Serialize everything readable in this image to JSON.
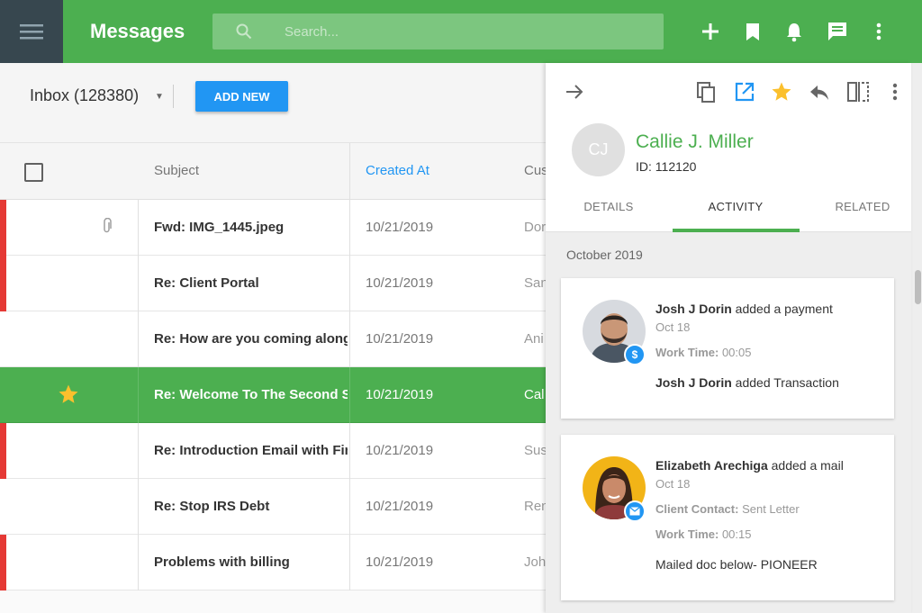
{
  "app": {
    "title": "Messages"
  },
  "search": {
    "placeholder": "Search..."
  },
  "topbar_icons": [
    "plus-icon",
    "bookmark-icon",
    "bell-icon",
    "chat-icon",
    "more-vert-icon"
  ],
  "toolbar": {
    "inbox_label": "Inbox (128380)",
    "add_new_label": "ADD NEW"
  },
  "table": {
    "headers": {
      "subject": "Subject",
      "created_at": "Created At",
      "customer": "Cus"
    },
    "rows": [
      {
        "subject": "Fwd: IMG_1445.jpeg",
        "date": "10/21/2019",
        "customer": "Dor",
        "flag": true,
        "attachment": true,
        "starred": false,
        "selected": false
      },
      {
        "subject": "Re: Client Portal",
        "date": "10/21/2019",
        "customer": "San",
        "flag": true,
        "attachment": false,
        "starred": false,
        "selected": false
      },
      {
        "subject": "Re: How are you coming along w",
        "date": "10/21/2019",
        "customer": "Ani",
        "flag": false,
        "attachment": false,
        "starred": false,
        "selected": false
      },
      {
        "subject": "Re: Welcome To The Second St",
        "date": "10/21/2019",
        "customer": "Cal",
        "flag": false,
        "attachment": false,
        "starred": true,
        "selected": true
      },
      {
        "subject": "Re: Introduction Email with Fina",
        "date": "10/21/2019",
        "customer": "Sus",
        "flag": true,
        "attachment": false,
        "starred": false,
        "selected": false
      },
      {
        "subject": "Re: Stop IRS Debt",
        "date": "10/21/2019",
        "customer": "Ren",
        "flag": false,
        "attachment": false,
        "starred": false,
        "selected": false
      },
      {
        "subject": "Problems with billing",
        "date": "10/21/2019",
        "customer": "Joh",
        "flag": true,
        "attachment": false,
        "starred": false,
        "selected": false
      }
    ]
  },
  "panel": {
    "icons": [
      "arrow-right-icon",
      "copy-icon",
      "open-external-icon",
      "star-icon",
      "reply-icon",
      "split-view-icon",
      "more-vert-icon"
    ],
    "contact": {
      "initials": "CJ",
      "name": "Callie J. Miller",
      "id": "ID: 112120"
    },
    "tabs": [
      "DETAILS",
      "ACTIVITY",
      "RELATED"
    ],
    "active_tab": "ACTIVITY",
    "month": "October 2019",
    "activities": [
      {
        "actor": "Josh J Dorin",
        "action": " added a payment",
        "date": "Oct 18",
        "work_time_label": "Work Time:",
        "work_time": " 00:05",
        "detail_bold": "Josh J Dorin",
        "detail_rest": " added Transaction",
        "badge": "dollar-icon"
      },
      {
        "actor": "Elizabeth Arechiga",
        "action": " added a mail",
        "date": "Oct 18",
        "contact_label": "Client Contact:",
        "contact_value": " Sent Letter",
        "work_time_label": "Work Time:",
        "work_time": " 00:15",
        "detail": "Mailed doc below- PIONEER",
        "badge": "mail-icon"
      }
    ]
  },
  "colors": {
    "brand_green": "#4caf50",
    "menu_dark": "#37474f",
    "accent_blue": "#2196f3",
    "flag_red": "#e53935",
    "star_yellow": "#fbc02d"
  }
}
